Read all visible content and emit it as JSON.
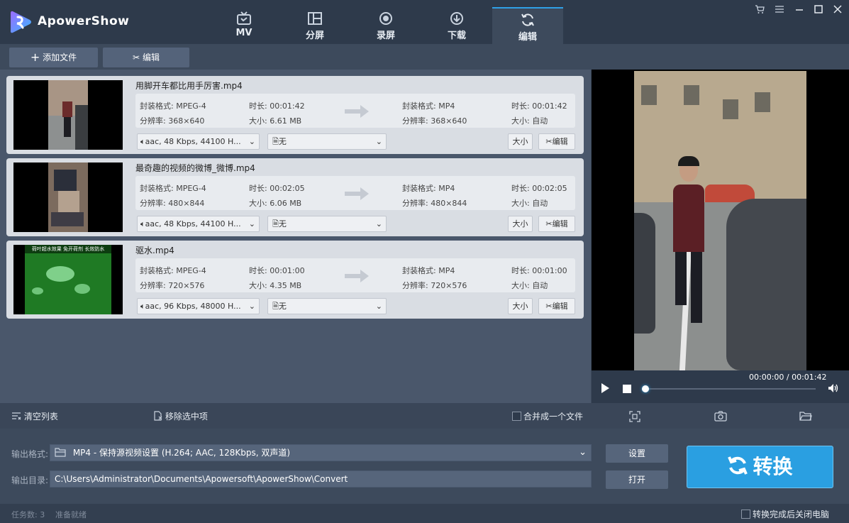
{
  "app": {
    "title": "ApowerShow"
  },
  "nav": {
    "tabs": [
      {
        "label": "MV",
        "icon": "tv-icon"
      },
      {
        "label": "分屏",
        "icon": "split-screen-icon"
      },
      {
        "label": "录屏",
        "icon": "record-icon"
      },
      {
        "label": "下载",
        "icon": "download-icon"
      },
      {
        "label": "编辑",
        "icon": "refresh-icon",
        "active": true
      }
    ]
  },
  "window_controls": [
    "cart-icon",
    "menu-icon",
    "minimize-icon",
    "maximize-icon",
    "close-icon"
  ],
  "toolbar": {
    "add_file": "添加文件",
    "edit": "编辑"
  },
  "files": [
    {
      "name": "用脚开车都比用手厉害.mp4",
      "src_format": "封装格式: MPEG-4",
      "src_duration": "时长: 00:01:42",
      "src_resolution": "分辨率: 368×640",
      "src_size": "大小: 6.61 MB",
      "dst_format": "封装格式: MP4",
      "dst_duration": "时长: 00:01:42",
      "dst_resolution": "分辨率: 368×640",
      "dst_size": "大小: 自动",
      "audio": "aac, 48 Kbps, 44100 H...",
      "subtitle": "无",
      "size_btn": "大小",
      "edit_btn": "编辑"
    },
    {
      "name": "最奇趣的视频的微博_微博.mp4",
      "src_format": "封装格式: MPEG-4",
      "src_duration": "时长: 00:02:05",
      "src_resolution": "分辨率: 480×844",
      "src_size": "大小: 6.06 MB",
      "dst_format": "封装格式: MP4",
      "dst_duration": "时长: 00:02:05",
      "dst_resolution": "分辨率: 480×844",
      "dst_size": "大小: 自动",
      "audio": "aac, 48 Kbps, 44100 H...",
      "subtitle": "无",
      "size_btn": "大小",
      "edit_btn": "编辑"
    },
    {
      "name": "驱水.mp4",
      "src_format": "封装格式: MPEG-4",
      "src_duration": "时长: 00:01:00",
      "src_resolution": "分辨率: 720×576",
      "src_size": "大小: 4.35 MB",
      "dst_format": "封装格式: MP4",
      "dst_duration": "时长: 00:01:00",
      "dst_resolution": "分辨率: 720×576",
      "dst_size": "大小: 自动",
      "audio": "aac, 96 Kbps, 48000 H...",
      "subtitle": "无",
      "size_btn": "大小",
      "edit_btn": "编辑",
      "thumb_caption": "荷叶超水效果 免开荷剂 长效防水"
    }
  ],
  "player": {
    "time": "00:00:00 / 00:01:42",
    "progress": 0.0
  },
  "list_actions": {
    "clear": "清空列表",
    "remove": "移除选中项",
    "merge": "合并成一个文件",
    "merge_checked": false
  },
  "output": {
    "format_label": "输出格式:",
    "format_value": "MP4 - 保持源视频设置 (H.264; AAC, 128Kbps, 双声道)",
    "dir_label": "输出目录:",
    "dir_value": "C:\\Users\\Administrator\\Documents\\Apowersoft\\ApowerShow\\Convert",
    "settings_btn": "设置",
    "open_btn": "打开",
    "convert_btn": "转换"
  },
  "status": {
    "tasks": "任务数: 3",
    "state": "准备就绪",
    "shutdown": "转换完成后关闭电脑",
    "shutdown_checked": false
  },
  "colors": {
    "accent": "#2a9fe1",
    "header": "#2e3a4b",
    "panel": "#3d4a5c"
  }
}
